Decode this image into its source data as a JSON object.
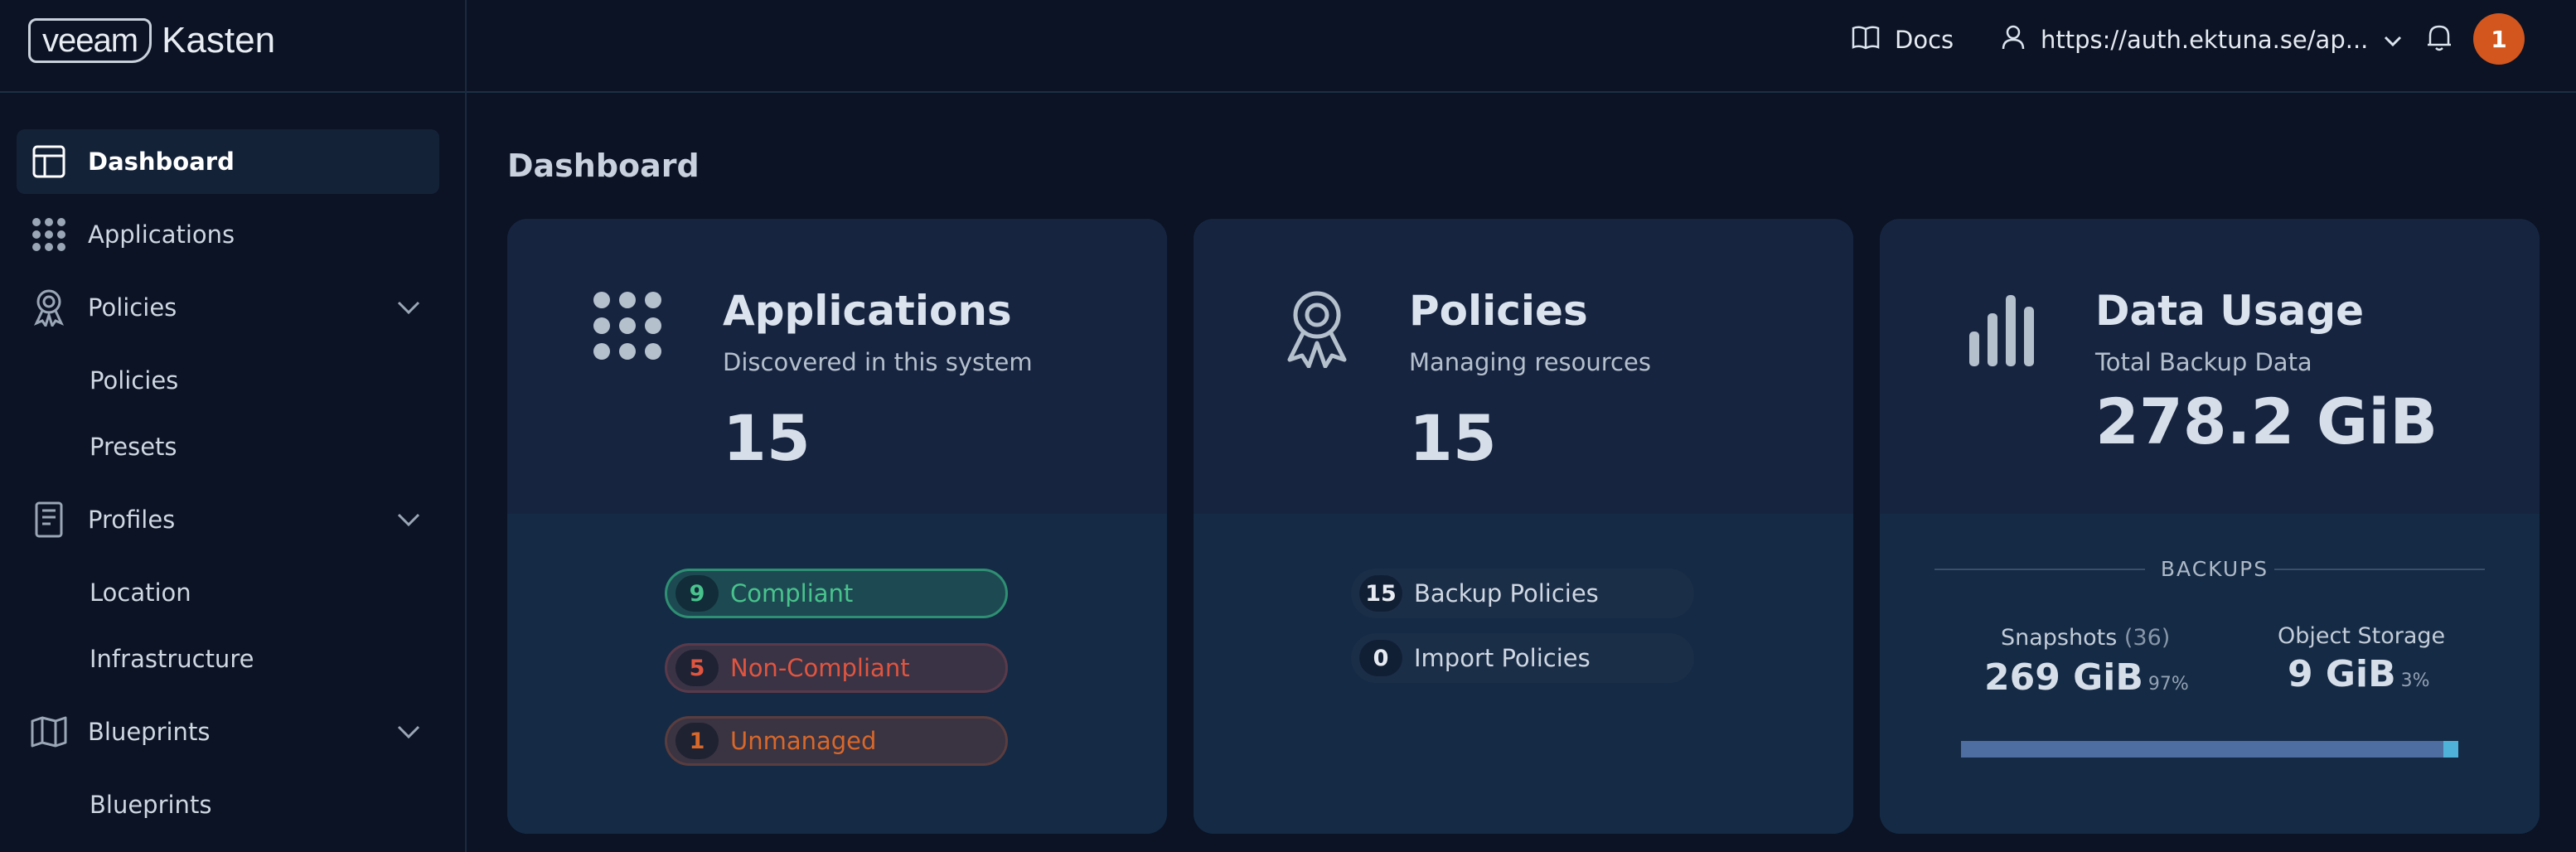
{
  "header": {
    "logo_box": "veeam",
    "logo_text": "Kasten",
    "docs_label": "Docs",
    "user_label": "https://auth.ektuna.se/ap...",
    "notification_count": "1",
    "badge_color": "#d2561e"
  },
  "sidebar": {
    "items": [
      {
        "label": "Dashboard",
        "icon": "dashboard-icon",
        "active": true
      },
      {
        "label": "Applications",
        "icon": "apps-grid-icon"
      },
      {
        "label": "Policies",
        "icon": "award-icon",
        "expanded": true
      },
      {
        "label": "Policies"
      },
      {
        "label": "Presets"
      },
      {
        "label": "Profiles",
        "icon": "profile-doc-icon",
        "expanded": true
      },
      {
        "label": "Location"
      },
      {
        "label": "Infrastructure"
      },
      {
        "label": "Blueprints",
        "icon": "map-icon",
        "expanded": true
      },
      {
        "label": "Blueprints"
      }
    ]
  },
  "main": {
    "title": "Dashboard",
    "cards": {
      "applications": {
        "title": "Applications",
        "subtitle": "Discovered in this system",
        "value": "15",
        "pills": [
          {
            "count": "9",
            "label": "Compliant"
          },
          {
            "count": "5",
            "label": "Non-Compliant"
          },
          {
            "count": "1",
            "label": "Unmanaged"
          }
        ]
      },
      "policies": {
        "title": "Policies",
        "subtitle": "Managing resources",
        "value": "15",
        "pills": [
          {
            "count": "15",
            "label": "Backup Policies"
          },
          {
            "count": "0",
            "label": "Import Policies"
          }
        ]
      },
      "data_usage": {
        "title": "Data Usage",
        "subtitle": "Total Backup Data",
        "value": "278.2 GiB",
        "section_label": "BACKUPS",
        "snapshots_label": "Snapshots",
        "snapshots_count": "(36)",
        "snapshots_value": "269 GiB",
        "snapshots_pct": "97%",
        "object_label": "Object Storage",
        "object_value": "9 GiB",
        "object_pct": "3%",
        "snapshots_fraction": 0.97,
        "object_fraction": 0.03
      }
    }
  },
  "colors": {
    "accent_green": "#49c38d",
    "accent_red": "#e0553f",
    "accent_orange": "#d8682a",
    "bar_snapshots": "#4e6da0",
    "bar_object": "#4fb3d9"
  }
}
